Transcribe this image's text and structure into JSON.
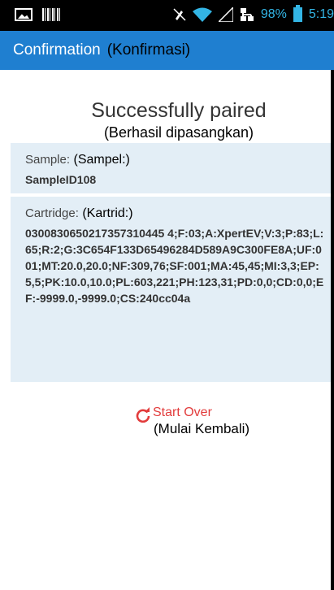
{
  "status_bar": {
    "battery_percent": "98%",
    "clock": "5:19",
    "accent_color": "#33b5e5",
    "icons": [
      "picture-icon",
      "barcode-icon",
      "mute-icon",
      "wifi-icon",
      "signal-icon",
      "network-icon",
      "battery-icon"
    ]
  },
  "action_bar": {
    "title": "Confirmation",
    "title_translation": "(Konfirmasi)",
    "color": "#1f7fd0"
  },
  "heading": {
    "main": "Successfully paired",
    "translation": "(Berhasil dipasangkan)"
  },
  "sample": {
    "label": "Sample:",
    "label_translation": "(Sampel:)",
    "value": "SampleID108"
  },
  "cartridge": {
    "label": "Cartridge:",
    "label_translation": "(Kartrid:)",
    "value": "0300830650217357310445 4;F:03;A:XpertEV;V:3;P:83;L:65;R:2;G:3C654F133D65496284D589A9C300FE8A;UF:001;MT:20.0,20.0;NF:309,76;SF:001;MA:45,45;MI:3,3;EP:5,5;PK:10.0,10.0;PL:603,221;PH:123,31;PD:0,0;CD:0,0;EF:-9999.0,-9999.0;CS:240cc04a"
  },
  "start_over": {
    "label": "Start Over",
    "translation": "(Mulai Kembali)",
    "color": "#e23c3c"
  }
}
